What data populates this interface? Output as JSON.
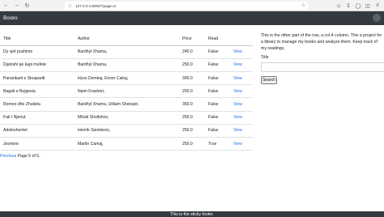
{
  "browser": {
    "url": "127.0.0.1:8000/?page=5"
  },
  "navbar": {
    "brand": "Books"
  },
  "table": {
    "headers": [
      "Title",
      "Author",
      "Price",
      "Read",
      ""
    ],
    "rows": [
      {
        "title": "Dy vjet pushime",
        "author": "Bardhyl Xhama,",
        "price": "240.0",
        "read": "False",
        "action": "View"
      },
      {
        "title": "Djaloshi qe kapi mufete",
        "author": "Bardhyl Xhama,",
        "price": "250.0",
        "read": "False",
        "action": "View"
      },
      {
        "title": "Panaritasit e Skrapartit",
        "author": "Hyso Demkaj, Enver Cakaj,",
        "price": "300.0",
        "read": "False",
        "action": "View"
      },
      {
        "title": "Bageti e Bujqesia",
        "author": "Naim Frasheri,",
        "price": "200.0",
        "read": "False",
        "action": "View"
      },
      {
        "title": "Romeo dhe Zhulieta",
        "author": "Bardhyl Xhama, Uilliam Shekspir,",
        "price": "350.0",
        "read": "False",
        "action": "View"
      },
      {
        "title": "Fati I Njeriut",
        "author": "Mihail Shollohov,",
        "price": "250.0",
        "read": "False",
        "action": "View"
      },
      {
        "title": "Adoleshentet",
        "author": "Henrik Sienkievic,",
        "price": "250.0",
        "read": "False",
        "action": "View"
      },
      {
        "title": "Jesmine",
        "author": "Martin Camaj,",
        "price": "250.0",
        "read": "True",
        "action": "View"
      }
    ]
  },
  "pagination": {
    "previous": "Previous",
    "status": " Page 5 of 5."
  },
  "sidebar": {
    "description": "This is the other part of the row, a col-4 column. This a project for a library to manage my books and analyze them. Keep track of my readings,",
    "field_label": "Title",
    "search_value": "",
    "search_button": "Search"
  },
  "footer": {
    "text": "This is the sticky footer."
  }
}
